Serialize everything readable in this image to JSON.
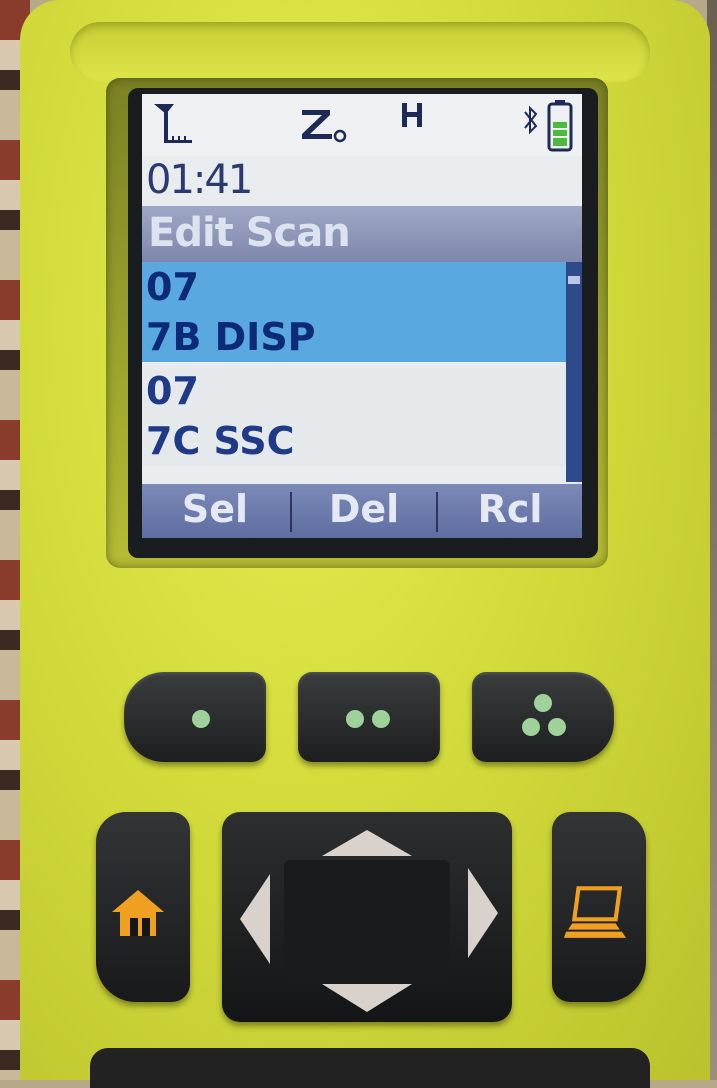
{
  "status": {
    "icons": [
      "signal-icon",
      "zoom-icon",
      "h-icon",
      "bluetooth-icon",
      "battery-icon"
    ],
    "h_label": "H"
  },
  "time": "01:41",
  "title": "Edit Scan",
  "list": {
    "items": [
      {
        "label": "07",
        "selected": true
      },
      {
        "label": "7B DISP",
        "selected": true
      },
      {
        "label": "07",
        "selected": false
      },
      {
        "label": "7C SSC",
        "selected": false
      }
    ]
  },
  "softkeys": {
    "left": "Sel",
    "middle": "Del",
    "right": "Rcl"
  },
  "hardware_keys": {
    "soft1_icon": "one-dot-icon",
    "soft2_icon": "two-dot-icon",
    "soft3_icon": "three-dot-icon",
    "home_icon": "home-icon",
    "computer_icon": "laptop-icon"
  },
  "colors": {
    "device_body": "#d4dc3c",
    "screen_bg": "#e9ecee",
    "selection": "#5aa8e0",
    "text_blue": "#1f3a86",
    "dot_green": "#9fd19a",
    "key_orange": "#f0a020"
  }
}
